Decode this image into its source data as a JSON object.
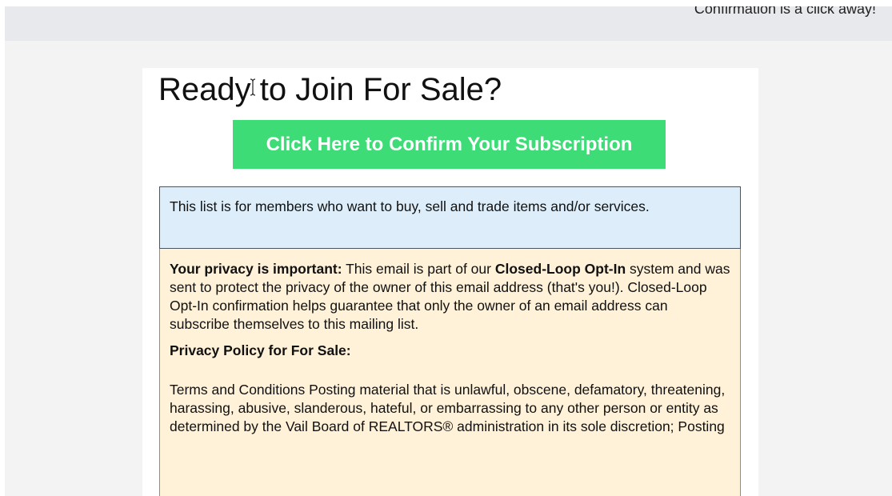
{
  "topbar": {
    "text": "Confirmation is a click away!"
  },
  "main": {
    "title": "Ready to Join For Sale?",
    "confirm_button": "Click Here to Confirm Your Subscription",
    "list_description": "This list is for members who want to buy, sell and trade items and/or services.",
    "privacy": {
      "label": "Your privacy is important:",
      "text_1": " This email is part of our ",
      "system_name": "Closed-Loop Opt-In",
      "text_2": " system and was sent to protect the privacy of the owner of this email address (that's you!). Closed-Loop Opt-In confirmation helps guarantee that only the owner of an email address can subscribe themselves to this mailing list."
    },
    "policy": {
      "heading": "Privacy Policy for For Sale:",
      "body": "Terms and Conditions Posting material that is unlawful, obscene, defamatory, threatening, harassing, abusive, slanderous, hateful, or embarrassing to any other person or entity as determined by the Vail Board of REALTORS® administration in its sole discretion; Posting"
    }
  },
  "colors": {
    "button_green": "#3ddc76",
    "info_blue": "#ddeefa",
    "privacy_cream": "#fff2d9",
    "privacy_border": "#b58a2b"
  },
  "icons": {
    "cursor": "text-cursor-icon"
  }
}
